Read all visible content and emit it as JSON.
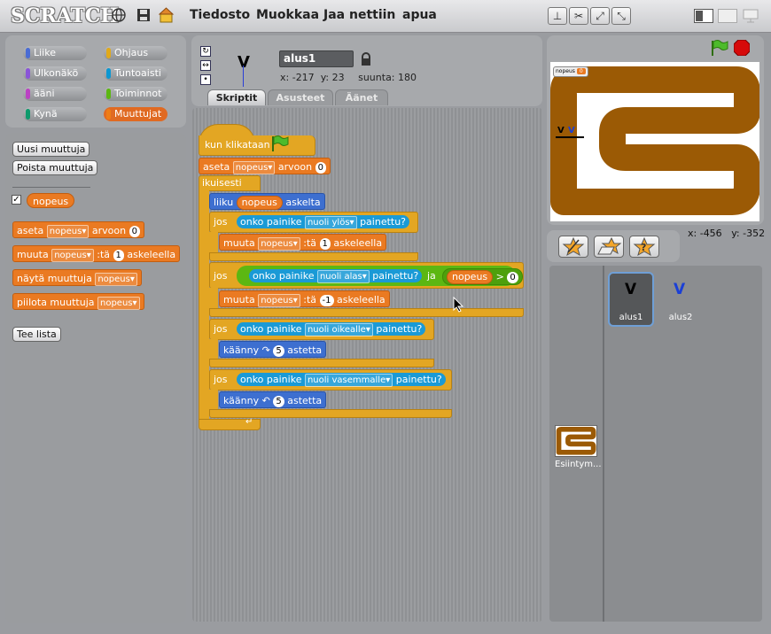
{
  "app": {
    "logo": "SCRATCH"
  },
  "menu": {
    "file": "Tiedosto",
    "edit": "Muokkaa",
    "share": "Jaa nettiin",
    "help": "apua"
  },
  "categories": [
    {
      "label": "Liike",
      "color": "#4a6cd4"
    },
    {
      "label": "Ohjaus",
      "color": "#e1a91a"
    },
    {
      "label": "Ulkonäkö",
      "color": "#8a55d7"
    },
    {
      "label": "Tuntoaisti",
      "color": "#0c97d2"
    },
    {
      "label": "ääni",
      "color": "#bb42c3"
    },
    {
      "label": "Toiminnot",
      "color": "#5cb712"
    },
    {
      "label": "Kynä",
      "color": "#0e9a6c"
    },
    {
      "label": "Muuttujat",
      "color": "#ee7d16"
    }
  ],
  "palette": {
    "new_var": "Uusi muuttuja",
    "delete_var": "Poista muuttuja",
    "var_name": "nopeus",
    "set_block": {
      "prefix": "aseta",
      "var": "nopeus",
      "mid": "arvoon",
      "value": "0"
    },
    "change_block": {
      "prefix": "muuta",
      "var": "nopeus",
      "mid": ":tä",
      "value": "1",
      "suffix": "askeleella"
    },
    "show_block": {
      "prefix": "näytä muuttuja",
      "var": "nopeus"
    },
    "hide_block": {
      "prefix": "piilota muuttuja",
      "var": "nopeus"
    },
    "make_list": "Tee lista"
  },
  "sprite_info": {
    "name": "alus1",
    "x_label": "x:",
    "x": "-217",
    "y_label": "y:",
    "y": "23",
    "dir_label": "suunta:",
    "dir": "180",
    "costume_glyph": "V"
  },
  "tabs": [
    "Skriptit",
    "Asusteet",
    "Äänet"
  ],
  "script": {
    "hat": "kun klikataan",
    "set": {
      "prefix": "aseta",
      "var": "nopeus",
      "mid": "arvoon",
      "value": "0"
    },
    "forever": "ikuisesti",
    "move": {
      "prefix": "liiku",
      "var": "nopeus",
      "suffix": "askelta"
    },
    "if1": {
      "kw": "jos",
      "sensor": "onko painike",
      "key": "nuoli ylös",
      "suffix": "painettu?"
    },
    "change1": {
      "prefix": "muuta",
      "var": "nopeus",
      "mid": ":tä",
      "value": "1",
      "suffix": "askeleella"
    },
    "if2": {
      "kw": "jos",
      "sensor": "onko painike",
      "key": "nuoli alas",
      "suffix": "painettu?",
      "and": "ja",
      "var": "nopeus",
      "op": ">",
      "value": "0"
    },
    "change2": {
      "prefix": "muuta",
      "var": "nopeus",
      "mid": ":tä",
      "value": "-1",
      "suffix": "askeleella"
    },
    "if3": {
      "kw": "jos",
      "sensor": "onko painike",
      "key": "nuoli oikealle",
      "suffix": "painettu?"
    },
    "turn1": {
      "prefix": "käänny",
      "value": "5",
      "suffix": "astetta"
    },
    "if4": {
      "kw": "jos",
      "sensor": "onko painike",
      "key": "nuoli vasemmalle",
      "suffix": "painettu?"
    },
    "turn2": {
      "prefix": "käänny",
      "value": "5",
      "suffix": "astetta"
    }
  },
  "stage": {
    "monitor_label": "nopeus",
    "monitor_value": "0",
    "sprite_glyphs": [
      "V",
      "V"
    ],
    "mouse_x_label": "x:",
    "mouse_x": "-456",
    "mouse_y_label": "y:",
    "mouse_y": "-352",
    "track_color": "#9b5a05"
  },
  "sprites": [
    {
      "name": "alus1",
      "glyph": "V",
      "color": "#000000"
    },
    {
      "name": "alus2",
      "glyph": "V",
      "color": "#1a3fd6"
    }
  ],
  "stage_thumb": {
    "label": "Esiintym..."
  }
}
